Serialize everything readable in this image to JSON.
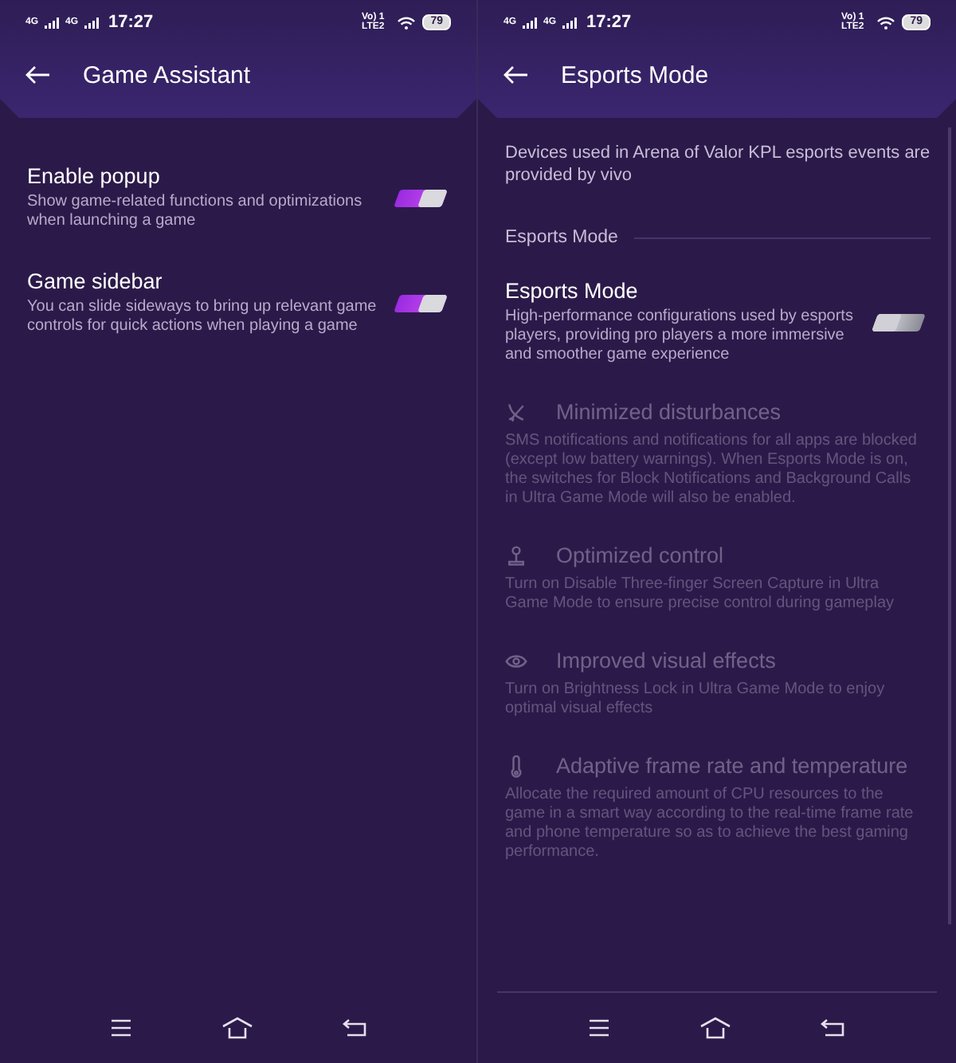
{
  "screens": [
    {
      "status": {
        "network_1": "4G",
        "network_2": "4G",
        "time": "17:27",
        "volte": "Vo) 1",
        "lte": "LTE2",
        "battery": "79"
      },
      "title": "Game Assistant",
      "scrollbar": false,
      "items": [
        {
          "kind": "toggle",
          "title": "Enable popup",
          "description": "Show game-related functions and optimizations when launching a game",
          "on": true
        },
        {
          "kind": "toggle",
          "title": "Game sidebar",
          "description": "You can slide sideways to bring up relevant game controls for quick actions when playing a game",
          "on": true
        }
      ]
    },
    {
      "status": {
        "network_1": "4G",
        "network_2": "4G",
        "time": "17:27",
        "volte": "Vo) 1",
        "lte": "LTE2",
        "battery": "79"
      },
      "title": "Esports Mode",
      "scrollbar": true,
      "items": [
        {
          "kind": "intro",
          "text": "Devices used in Arena of Valor KPL esports events are provided by vivo"
        },
        {
          "kind": "section",
          "text": "Esports Mode"
        },
        {
          "kind": "toggle",
          "title": "Esports Mode",
          "description": "High-performance configurations used by esports players, providing pro players a more immersive and smoother game experience",
          "on": false
        },
        {
          "kind": "feature",
          "title": "Minimized disturbances",
          "description": "SMS notifications and notifications for all apps are blocked (except low battery warnings). When Esports Mode is on, the switches for Block Notifications and Background Calls in Ultra Game Mode will also be enabled.",
          "disabled": true
        },
        {
          "kind": "feature",
          "title": "Optimized control",
          "description": "Turn on Disable Three-finger Screen Capture in Ultra Game Mode to ensure precise control during gameplay",
          "disabled": true
        },
        {
          "kind": "feature",
          "title": "Improved visual effects",
          "description": "Turn on Brightness Lock in Ultra Game Mode to enjoy optimal visual effects",
          "disabled": true
        },
        {
          "kind": "feature",
          "title": "Adaptive frame rate and temperature",
          "description": "Allocate the required amount of CPU resources to the game in a smart way according to the real-time frame rate and phone temperature so as to achieve the best gaming performance.",
          "disabled": true
        }
      ]
    }
  ]
}
